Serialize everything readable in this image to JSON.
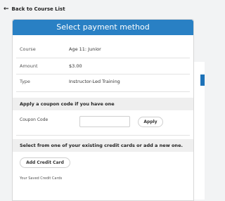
{
  "nav": {
    "back_label": "Back to Course List"
  },
  "header": {
    "title": "Select payment method"
  },
  "details": [
    {
      "key": "Course",
      "value": "Age 11: Junior"
    },
    {
      "key": "Amount",
      "value": "$3.00"
    },
    {
      "key": "Type",
      "value": "Instructor-Led Training"
    }
  ],
  "coupon": {
    "section_title": "Apply a coupon code if you have one",
    "label": "Coupon Code",
    "value": "",
    "apply_label": "Apply"
  },
  "cards": {
    "section_title": "Select from one of your existing credit cards or add a new one.",
    "add_label": "Add Credit Card",
    "saved_label": "Your Saved Credit Cards"
  },
  "colors": {
    "accent": "#2980c4"
  },
  "icons": {
    "back": "arrow-left-icon"
  }
}
